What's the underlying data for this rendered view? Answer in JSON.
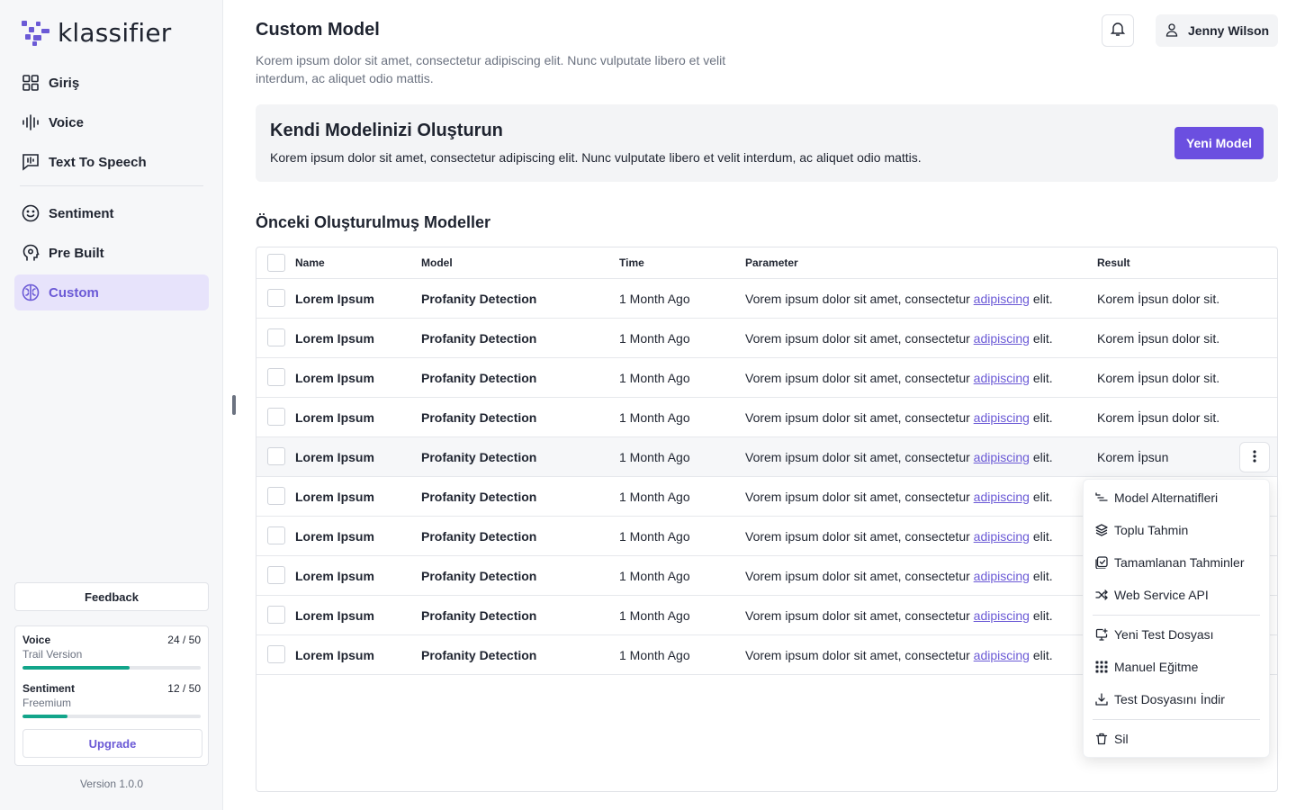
{
  "app": {
    "brand": "klassifier",
    "version": "Version 1.0.0"
  },
  "sidebar": {
    "items": [
      {
        "label": "Giriş",
        "icon": "grid-icon",
        "active": false
      },
      {
        "label": "Voice",
        "icon": "waveform-icon",
        "active": false
      },
      {
        "label": "Text To Speech",
        "icon": "speech-chat-icon",
        "active": false
      },
      {
        "label": "Sentiment",
        "icon": "smiley-icon",
        "active": false
      },
      {
        "label": "Pre Built",
        "icon": "head-gear-icon",
        "active": false
      },
      {
        "label": "Custom",
        "icon": "brain-icon",
        "active": true
      }
    ],
    "feedback_label": "Feedback",
    "usage": [
      {
        "title": "Voice",
        "count": "24 / 50",
        "plan": "Trail Version",
        "progress": 0.6
      },
      {
        "title": "Sentiment",
        "count": "12 / 50",
        "plan": "Freemium",
        "progress": 0.25
      }
    ],
    "upgrade_label": "Upgrade"
  },
  "header": {
    "title": "Custom Model",
    "description": "Korem ipsum dolor sit amet, consectetur adipiscing elit. Nunc vulputate libero et velit interdum, ac aliquet odio mattis.",
    "user_name": "Jenny Wilson"
  },
  "banner": {
    "title": "Kendi Modelinizi Oluşturun",
    "description": "Korem ipsum dolor sit amet, consectetur adipiscing elit. Nunc vulputate libero et velit interdum, ac aliquet odio mattis.",
    "button_label": "Yeni Model"
  },
  "models": {
    "section_title": "Önceki Oluşturulmuş Modeller",
    "columns": [
      "Name",
      "Model",
      "Time",
      "Parameter",
      "Result"
    ],
    "rows": [
      {
        "name": "Lorem Ipsum",
        "model": "Profanity Detection",
        "time": "1 Month Ago",
        "param_before": "Vorem ipsum dolor sit amet, consectetur ",
        "param_link": "adipiscing",
        "param_after": " elit.",
        "result": "Korem İpsun dolor sit."
      },
      {
        "name": "Lorem Ipsum",
        "model": "Profanity Detection",
        "time": "1 Month Ago",
        "param_before": "Vorem ipsum dolor sit amet, consectetur ",
        "param_link": "adipiscing",
        "param_after": " elit.",
        "result": "Korem İpsun dolor sit."
      },
      {
        "name": "Lorem Ipsum",
        "model": "Profanity Detection",
        "time": "1 Month Ago",
        "param_before": "Vorem ipsum dolor sit amet, consectetur ",
        "param_link": "adipiscing",
        "param_after": " elit.",
        "result": "Korem İpsun dolor sit."
      },
      {
        "name": "Lorem Ipsum",
        "model": "Profanity Detection",
        "time": "1 Month Ago",
        "param_before": "Vorem ipsum dolor sit amet, consectetur ",
        "param_link": "adipiscing",
        "param_after": " elit.",
        "result": "Korem İpsun dolor sit."
      },
      {
        "name": "Lorem Ipsum",
        "model": "Profanity Detection",
        "time": "1 Month Ago",
        "param_before": "Vorem ipsum dolor sit amet, consectetur ",
        "param_link": "adipiscing",
        "param_after": " elit.",
        "result": "Korem İpsun"
      },
      {
        "name": "Lorem Ipsum",
        "model": "Profanity Detection",
        "time": "1 Month Ago",
        "param_before": "Vorem ipsum dolor sit amet, consectetur ",
        "param_link": "adipiscing",
        "param_after": " elit.",
        "result": ""
      },
      {
        "name": "Lorem Ipsum",
        "model": "Profanity Detection",
        "time": "1 Month Ago",
        "param_before": "Vorem ipsum dolor sit amet, consectetur ",
        "param_link": "adipiscing",
        "param_after": " elit.",
        "result": ""
      },
      {
        "name": "Lorem Ipsum",
        "model": "Profanity Detection",
        "time": "1 Month Ago",
        "param_before": "Vorem ipsum dolor sit amet, consectetur ",
        "param_link": "adipiscing",
        "param_after": " elit.",
        "result": ""
      },
      {
        "name": "Lorem Ipsum",
        "model": "Profanity Detection",
        "time": "1 Month Ago",
        "param_before": "Vorem ipsum dolor sit amet, consectetur ",
        "param_link": "adipiscing",
        "param_after": " elit.",
        "result": ""
      },
      {
        "name": "Lorem Ipsum",
        "model": "Profanity Detection",
        "time": "1 Month Ago",
        "param_before": "Vorem ipsum dolor sit amet, consectetur ",
        "param_link": "adipiscing",
        "param_after": " elit.",
        "result": ""
      }
    ]
  },
  "row_menu": {
    "items": [
      {
        "label": "Model Alternatifleri",
        "icon": "list-tree-icon"
      },
      {
        "label": "Toplu Tahmin",
        "icon": "layers-icon"
      },
      {
        "label": "Tamamlanan Tahminler",
        "icon": "checked-box-icon"
      },
      {
        "label": "Web Service API",
        "icon": "shuffle-icon"
      },
      {
        "label": "Yeni Test Dosyası",
        "icon": "monitor-plus-icon"
      },
      {
        "label": "Manuel Eğitme",
        "icon": "dots-grid-icon"
      },
      {
        "label": "Test Dosyasını İndir",
        "icon": "download-icon"
      },
      {
        "label": "Sil",
        "icon": "trash-icon"
      }
    ]
  },
  "colors": {
    "accent": "#6b5ad6",
    "primary_button": "#6b4fe0",
    "progress": "#12a58a"
  }
}
